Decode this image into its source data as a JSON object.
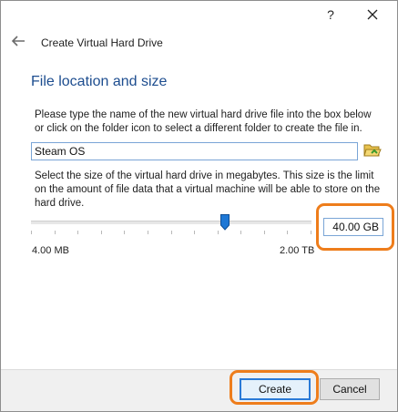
{
  "titlebar": {
    "help_label": "?",
    "close_icon": "close-icon"
  },
  "header": {
    "back_icon": "back-arrow-icon",
    "title": "Create Virtual Hard Drive"
  },
  "main": {
    "section_title": "File location and size",
    "location_description": "Please type the name of the new virtual hard drive file into the box below or click on the folder icon to select a different folder to create the file in.",
    "file_name_value": "Steam OS",
    "folder_icon": "folder-open-icon",
    "size_description": "Select the size of the virtual hard drive in megabytes. This size is the limit on the amount of file data that a virtual machine will be able to store on the hard drive.",
    "size_value": "40.00 GB",
    "slider_fraction": 0.69,
    "range_min": "4.00 MB",
    "range_max": "2.00 TB"
  },
  "footer": {
    "create_label": "Create",
    "cancel_label": "Cancel"
  },
  "colors": {
    "accent": "#2a7ad7",
    "section_title": "#1d4d8f",
    "annotation_highlight": "#ee7d1b"
  }
}
